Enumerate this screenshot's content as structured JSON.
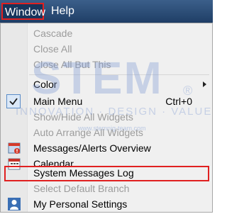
{
  "menubar": {
    "window_label": "Window",
    "help_label": "Help",
    "highlight_color": "#e02020"
  },
  "menu": {
    "items": [
      {
        "label": "Cascade",
        "enabled": false
      },
      {
        "label": "Close All",
        "enabled": false
      },
      {
        "label": "Close All But This",
        "enabled": false
      },
      {
        "label": "Color",
        "enabled": true,
        "submenu": true
      },
      {
        "label": "Main Menu",
        "enabled": true,
        "checked": true,
        "shortcut": "Ctrl+0"
      },
      {
        "label": "Show/Hide All Widgets",
        "enabled": false
      },
      {
        "label": "Auto Arrange All Widgets",
        "enabled": false
      },
      {
        "label": "Messages/Alerts Overview",
        "enabled": true,
        "icon": "alerts-icon"
      },
      {
        "label": "Calendar",
        "enabled": true,
        "icon": "calendar-icon"
      },
      {
        "label": "System Messages Log",
        "enabled": true,
        "highlighted": true
      },
      {
        "label": "Select Default Branch",
        "enabled": false
      },
      {
        "label": "My Personal Settings",
        "enabled": true,
        "icon": "user-icon"
      }
    ]
  },
  "watermark": {
    "logo": "STEM",
    "registered": "®",
    "tagline": "INNOVATION · DESIGN · VALUE",
    "url": "www.stemnig-team.com"
  }
}
